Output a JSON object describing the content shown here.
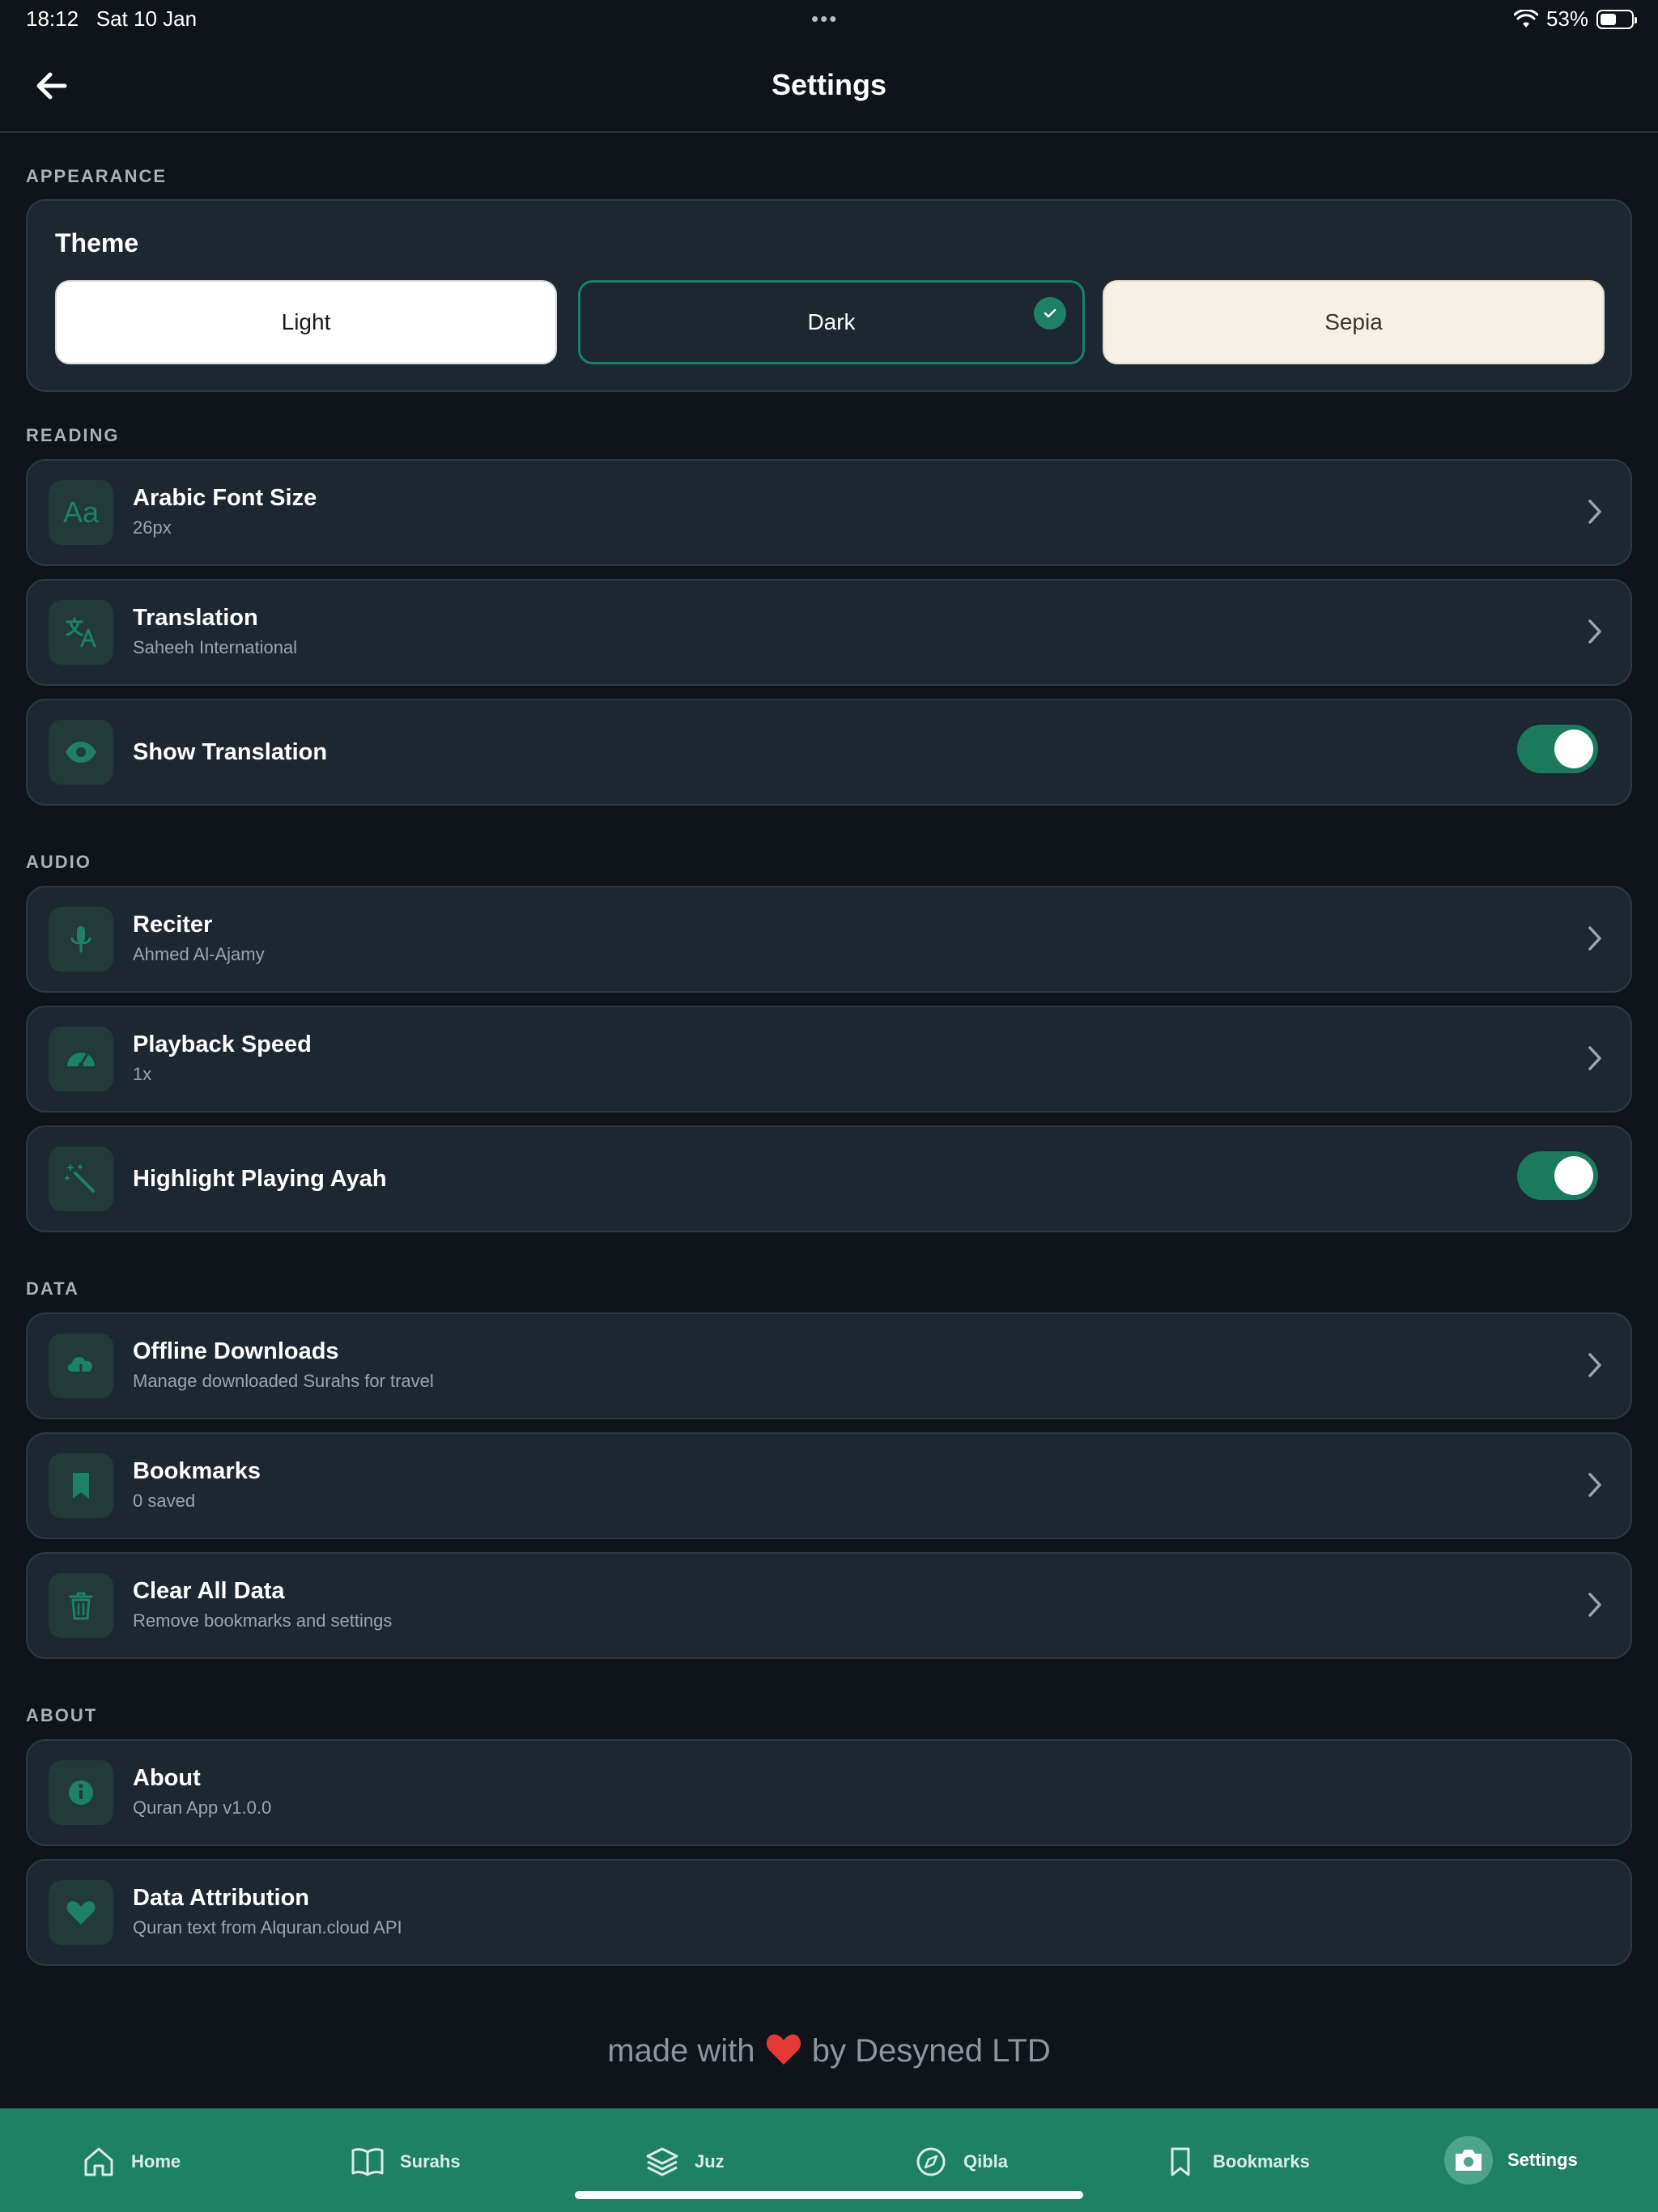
{
  "status": {
    "time": "18:12",
    "date": "Sat 10 Jan",
    "battery": "53%",
    "battery_level": 0.53
  },
  "header": {
    "title": "Settings"
  },
  "sections": {
    "appearance": "APPEARANCE",
    "reading": "READING",
    "audio": "AUDIO",
    "data": "DATA",
    "about": "ABOUT"
  },
  "theme": {
    "title": "Theme",
    "light": "Light",
    "dark": "Dark",
    "sepia": "Sepia",
    "selected": "Dark"
  },
  "reading": {
    "font_size": {
      "title": "Arabic Font Size",
      "value": "26px"
    },
    "translation": {
      "title": "Translation",
      "value": "Saheeh International"
    },
    "show_translation": {
      "title": "Show Translation",
      "on": true
    }
  },
  "audio": {
    "reciter": {
      "title": "Reciter",
      "value": "Ahmed Al-Ajamy"
    },
    "playback": {
      "title": "Playback Speed",
      "value": "1x"
    },
    "highlight": {
      "title": "Highlight Playing Ayah",
      "on": true
    }
  },
  "data": {
    "offline": {
      "title": "Offline Downloads",
      "value": "Manage downloaded Surahs for travel"
    },
    "bookmarks": {
      "title": "Bookmarks",
      "value": "0 saved"
    },
    "clear": {
      "title": "Clear All Data",
      "value": "Remove bookmarks and settings"
    }
  },
  "about": {
    "about": {
      "title": "About",
      "value": "Quran App v1.0.0"
    },
    "attribution": {
      "title": "Data Attribution",
      "value": "Quran text from Alquran.cloud API"
    }
  },
  "footer": {
    "made_with": "made with",
    "by": "by Desyned LTD"
  },
  "tabs": {
    "home": "Home",
    "surahs": "Surahs",
    "juz": "Juz",
    "qibla": "Qibla",
    "bookmarks": "Bookmarks",
    "settings": "Settings"
  },
  "colors": {
    "accent": "#1f8164",
    "card": "#1d2732",
    "background": "#0e1419"
  }
}
